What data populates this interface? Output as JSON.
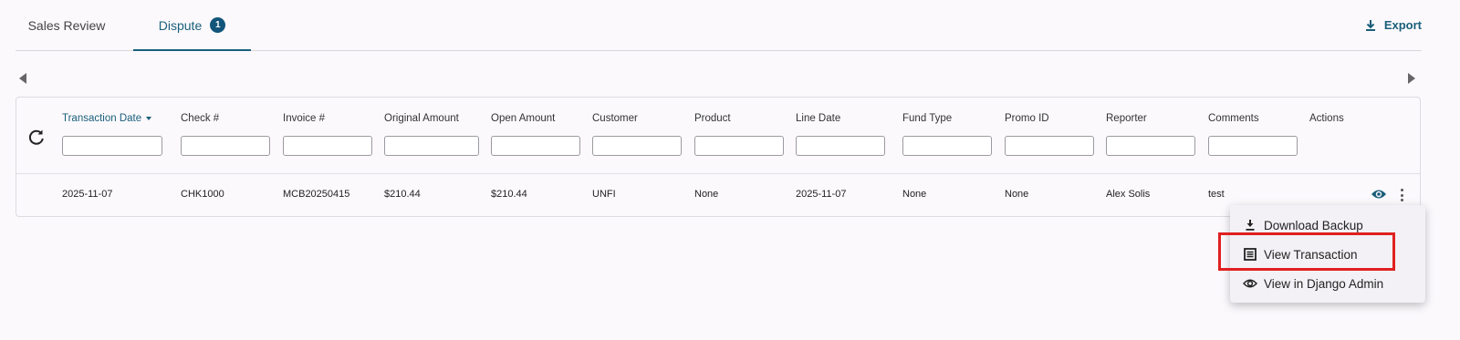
{
  "tabs": [
    {
      "label": "Sales Review"
    },
    {
      "label": "Dispute",
      "badge": "1"
    }
  ],
  "export_label": "Export",
  "table": {
    "columns": [
      {
        "label": "Transaction Date",
        "sorted": "desc"
      },
      {
        "label": "Check #"
      },
      {
        "label": "Invoice #"
      },
      {
        "label": "Original Amount"
      },
      {
        "label": "Open Amount"
      },
      {
        "label": "Customer"
      },
      {
        "label": "Product"
      },
      {
        "label": "Line Date"
      },
      {
        "label": "Fund Type"
      },
      {
        "label": "Promo ID"
      },
      {
        "label": "Reporter"
      },
      {
        "label": "Comments"
      },
      {
        "label": "Actions"
      }
    ],
    "rows": [
      {
        "cells": [
          "2025-11-07",
          "CHK1000",
          "MCB20250415",
          "$210.44",
          "$210.44",
          "UNFI",
          "None",
          "2025-11-07",
          "None",
          "None",
          "Alex Solis",
          "test"
        ]
      }
    ]
  },
  "menu": {
    "items": [
      {
        "label": "Download Backup",
        "icon": "download-icon"
      },
      {
        "label": "View Transaction",
        "icon": "document-icon"
      },
      {
        "label": "View in Django Admin",
        "icon": "eye-icon"
      }
    ]
  },
  "colors": {
    "accent": "#1a5f7a",
    "highlight_border": "#e02020",
    "background": "#fbf9fc"
  }
}
